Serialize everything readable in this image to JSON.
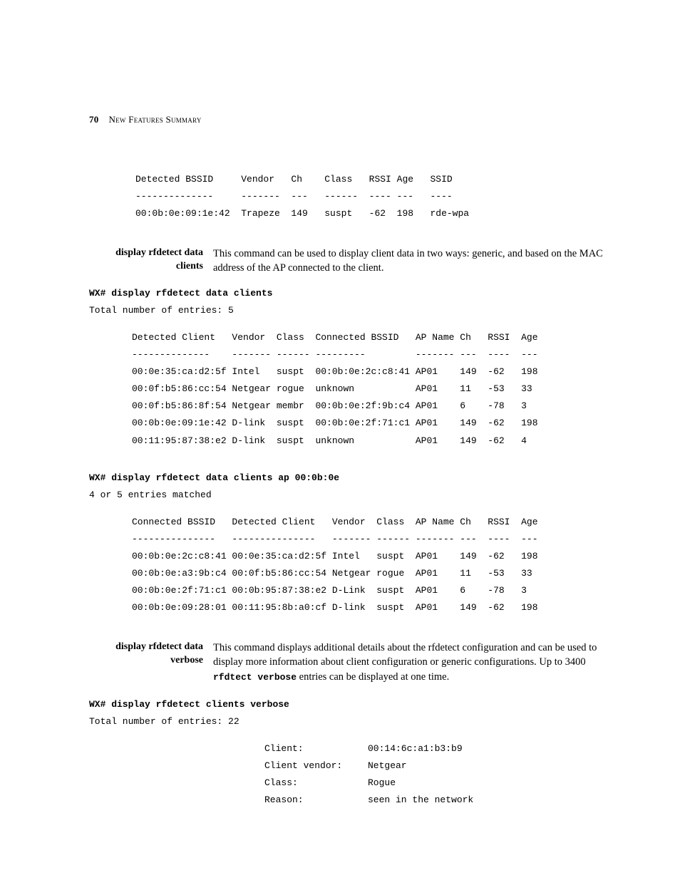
{
  "page": {
    "number": "70",
    "chapter_smallcaps": "New Features Summary"
  },
  "top_table": {
    "headers": "Detected BSSID     Vendor   Ch    Class   RSSI Age   SSID",
    "rule": "--------------     -------  ---   ------  ---- ---   ----",
    "row": "00:0b:0e:09:1e:42  Trapeze  149   suspt   -62  198   rde-wpa"
  },
  "section_clients": {
    "label": "display rfdetect data clients",
    "desc": "This command can be used to display client data in two ways: generic, and based on the MAC address of the AP connected to the client.",
    "cmd1": "WX# display rfdetect data clients",
    "msg1": "Total number of entries: 5",
    "table1": {
      "h": "Detected Client   Vendor  Class  Connected BSSID   AP Name Ch   RSSI  Age",
      "r": "--------------    ------- ------ ---------         ------- ---  ----  ---",
      "d1": "00:0e:35:ca:d2:5f Intel   suspt  00:0b:0e:2c:c8:41 AP01    149  -62   198",
      "d2": "00:0f:b5:86:cc:54 Netgear rogue  unknown           AP01    11   -53   33",
      "d3": "00:0f:b5:86:8f:54 Netgear membr  00:0b:0e:2f:9b:c4 AP01    6    -78   3",
      "d4": "00:0b:0e:09:1e:42 D-link  suspt  00:0b:0e:2f:71:c1 AP01    149  -62   198",
      "d5": "00:11:95:87:38:e2 D-link  suspt  unknown           AP01    149  -62   4"
    },
    "cmd2": "WX# display rfdetect data clients ap 00:0b:0e",
    "msg2": "4 or 5 entries matched",
    "table2": {
      "h": "Connected BSSID   Detected Client   Vendor  Class  AP Name Ch   RSSI  Age",
      "r": "---------------   ---------------   ------- ------ ------- ---  ----  ---",
      "d1": "00:0b:0e:2c:c8:41 00:0e:35:ca:d2:5f Intel   suspt  AP01    149  -62   198",
      "d2": "00:0b:0e:a3:9b:c4 00:0f:b5:86:cc:54 Netgear rogue  AP01    11   -53   33",
      "d3": "00:0b:0e:2f:71:c1 00:0b:95:87:38:e2 D-Link  suspt  AP01    6    -78   3",
      "d4": "00:0b:0e:09:28:01 00:11:95:8b:a0:cf D-link  suspt  AP01    149  -62   198"
    }
  },
  "section_verbose": {
    "label": "display rfdetect data verbose",
    "desc_pre": "This command displays additional details about the rfdetect configuration and can be used to display more information about client configuration or generic configurations. Up to 3400 ",
    "desc_code": "rfdtect verbose",
    "desc_post": " entries can be displayed at one time.",
    "cmd": "WX# display rfdetect clients verbose",
    "msg": "Total number of entries: 22",
    "kv": {
      "k1": "Client:",
      "v1": "00:14:6c:a1:b3:b9",
      "k2": "Client vendor:",
      "v2": "Netgear",
      "k3": "Class:",
      "v3": "Rogue",
      "k4": "Reason:",
      "v4": "seen in the network"
    }
  }
}
